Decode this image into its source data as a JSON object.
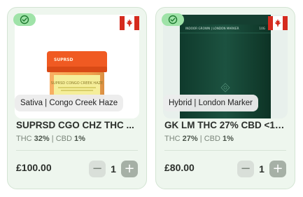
{
  "colors": {
    "card_bg": "#eef6ee",
    "badge_green": "#9fe3a8",
    "flag_red": "#d52b1e",
    "text_dark": "#2b2f2b",
    "text_muted": "#7b867b",
    "stepper_plus": "#a6b0a6"
  },
  "products": [
    {
      "strain_label": "Sativa | Congo Creek Haze",
      "name": "SUPRSD CGO CHZ THC ...",
      "thc_label": "THC",
      "thc_value": "32%",
      "separator": "|",
      "cbd_label": "CBD",
      "cbd_value": "1%",
      "price": "£100.00",
      "quantity": "1",
      "minus_symbol": "−",
      "plus_symbol": "+",
      "badge_icon": "check-circle-icon",
      "flag_icon": "canada-flag-icon",
      "jar_brand": "SUPRSD",
      "jar_label": "SUPRSD CONGO CREEK HAZE"
    },
    {
      "strain_label": "Hybrid | London Marker",
      "name": "GK LM THC 27% CBD <1%...",
      "thc_label": "THC",
      "thc_value": "27%",
      "separator": "|",
      "cbd_label": "CBD",
      "cbd_value": "1%",
      "price": "£80.00",
      "quantity": "1",
      "minus_symbol": "−",
      "plus_symbol": "+",
      "badge_icon": "check-circle-icon",
      "flag_icon": "canada-flag-icon",
      "pouch_top_text": "INDOOR GROWN | LONDON MARKER",
      "pouch_top_right": "10G",
      "pouch_brand": "GREEN KARAT"
    }
  ]
}
